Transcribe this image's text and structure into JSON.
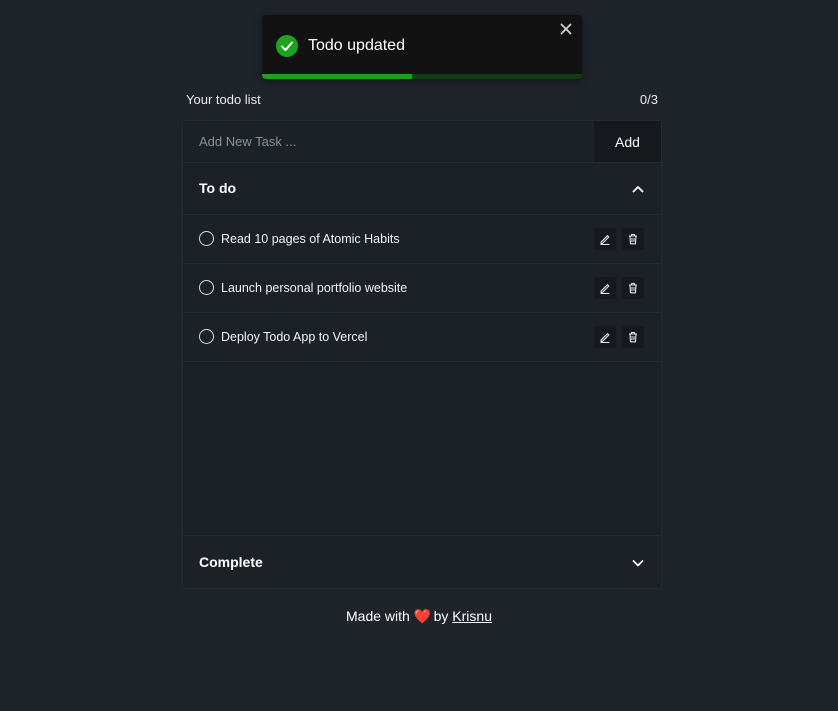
{
  "toast": {
    "message": "Todo updated",
    "progress": 0.47,
    "icon": "check-circle-icon",
    "close_icon": "close-icon",
    "accent_color": "#1ea31e"
  },
  "header": {
    "title": "Your todo list",
    "count": "0/3"
  },
  "add_task": {
    "placeholder": "Add New Task ...",
    "value": "",
    "button_label": "Add"
  },
  "todo_section": {
    "title": "To do",
    "expanded": true,
    "items": [
      {
        "label": "Read 10 pages of Atomic Habits",
        "done": false
      },
      {
        "label": "Launch personal portfolio website",
        "done": false
      },
      {
        "label": "Deploy Todo App to Vercel",
        "done": false
      }
    ]
  },
  "complete_section": {
    "title": "Complete",
    "expanded": false
  },
  "footer": {
    "prefix": "Made with",
    "heart": "❤️",
    "by": "by",
    "author": "Krisnu"
  }
}
